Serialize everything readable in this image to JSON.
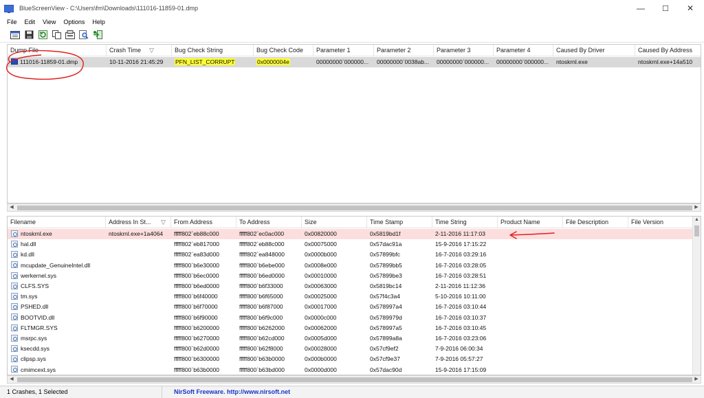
{
  "window": {
    "title": "BlueScreenView  -  C:\\Users\\fm\\Downloads\\111016-11859-01.dmp",
    "minimize": "—",
    "maximize": "☐",
    "close": "✕"
  },
  "menu": [
    "File",
    "Edit",
    "View",
    "Options",
    "Help"
  ],
  "toolbar": {
    "icons": [
      "properties-icon",
      "save-icon",
      "refresh-icon",
      "copy-icon",
      "options-icon",
      "find-icon",
      "exit-icon"
    ]
  },
  "crashes": {
    "columns": [
      "Dump File",
      "Crash Time",
      "Bug Check String",
      "Bug Check Code",
      "Parameter 1",
      "Parameter 2",
      "Parameter 3",
      "Parameter 4",
      "Caused By Driver",
      "Caused By Address"
    ],
    "sort_indicator": "▽",
    "rows": [
      {
        "dump_file": "111016-11859-01.dmp",
        "crash_time": "10-11-2016 21:45:29",
        "bug_check_string": "PFN_LIST_CORRUPT",
        "bug_check_code": "0x0000004e",
        "param1": "00000000`000000...",
        "param2": "00000000`0038ab...",
        "param3": "00000000`000000...",
        "param4": "00000000`000000...",
        "caused_by_driver": "ntoskrnl.exe",
        "caused_by_address": "ntoskrnl.exe+14a510"
      }
    ]
  },
  "drivers": {
    "columns": [
      "Filename",
      "Address In St...",
      "From Address",
      "To Address",
      "Size",
      "Time Stamp",
      "Time String",
      "Product Name",
      "File Description",
      "File Version"
    ],
    "sort_indicator": "▽",
    "rows": [
      {
        "filename": "ntoskrnl.exe",
        "addr_in_stack": "ntoskrnl.exe+1a4064",
        "from": "fffff802`eb88c000",
        "to": "fffff802`ec0ac000",
        "size": "0x00820000",
        "timestamp": "0x5819bd1f",
        "timestring": "2-11-2016 11:17:03"
      },
      {
        "filename": "hal.dll",
        "addr_in_stack": "",
        "from": "fffff802`eb817000",
        "to": "fffff802`eb88c000",
        "size": "0x00075000",
        "timestamp": "0x57dac91a",
        "timestring": "15-9-2016 17:15:22"
      },
      {
        "filename": "kd.dll",
        "addr_in_stack": "",
        "from": "fffff802`ea83d000",
        "to": "fffff802`ea848000",
        "size": "0x0000b000",
        "timestamp": "0x57899bfc",
        "timestring": "16-7-2016 03:29:16"
      },
      {
        "filename": "mcupdate_GenuineIntel.dll",
        "addr_in_stack": "",
        "from": "fffff800`b6e30000",
        "to": "fffff800`b6ebe000",
        "size": "0x0008e000",
        "timestamp": "0x57899bb5",
        "timestring": "16-7-2016 03:28:05"
      },
      {
        "filename": "werkernel.sys",
        "addr_in_stack": "",
        "from": "fffff800`b6ec0000",
        "to": "fffff800`b6ed0000",
        "size": "0x00010000",
        "timestamp": "0x57899be3",
        "timestring": "16-7-2016 03:28:51"
      },
      {
        "filename": "CLFS.SYS",
        "addr_in_stack": "",
        "from": "fffff800`b6ed0000",
        "to": "fffff800`b6f33000",
        "size": "0x00063000",
        "timestamp": "0x5819bc14",
        "timestring": "2-11-2016 11:12:36"
      },
      {
        "filename": "tm.sys",
        "addr_in_stack": "",
        "from": "fffff800`b6f40000",
        "to": "fffff800`b6f65000",
        "size": "0x00025000",
        "timestamp": "0x57f4c3a4",
        "timestring": "5-10-2016 10:11:00"
      },
      {
        "filename": "PSHED.dll",
        "addr_in_stack": "",
        "from": "fffff800`b6f70000",
        "to": "fffff800`b6f87000",
        "size": "0x00017000",
        "timestamp": "0x578997a4",
        "timestring": "16-7-2016 03:10:44"
      },
      {
        "filename": "BOOTVID.dll",
        "addr_in_stack": "",
        "from": "fffff800`b6f90000",
        "to": "fffff800`b6f9c000",
        "size": "0x0000c000",
        "timestamp": "0x5789979d",
        "timestring": "16-7-2016 03:10:37"
      },
      {
        "filename": "FLTMGR.SYS",
        "addr_in_stack": "",
        "from": "fffff800`b6200000",
        "to": "fffff800`b6262000",
        "size": "0x00062000",
        "timestamp": "0x578997a5",
        "timestring": "16-7-2016 03:10:45"
      },
      {
        "filename": "msrpc.sys",
        "addr_in_stack": "",
        "from": "fffff800`b6270000",
        "to": "fffff800`b62cd000",
        "size": "0x0005d000",
        "timestamp": "0x57899a8a",
        "timestring": "16-7-2016 03:23:06"
      },
      {
        "filename": "ksecdd.sys",
        "addr_in_stack": "",
        "from": "fffff800`b62d0000",
        "to": "fffff800`b62f8000",
        "size": "0x00028000",
        "timestamp": "0x57cf9ef2",
        "timestring": "7-9-2016 06:00:34"
      },
      {
        "filename": "clipsp.sys",
        "addr_in_stack": "",
        "from": "fffff800`b6300000",
        "to": "fffff800`b63b0000",
        "size": "0x000b0000",
        "timestamp": "0x57cf9e37",
        "timestring": "7-9-2016 05:57:27"
      },
      {
        "filename": "cmimcext.sys",
        "addr_in_stack": "",
        "from": "fffff800`b63b0000",
        "to": "fffff800`b63bd000",
        "size": "0x0000d000",
        "timestamp": "0x57dac90d",
        "timestring": "15-9-2016 17:15:09"
      }
    ]
  },
  "status": {
    "count": "1 Crashes, 1 Selected",
    "link": "NirSoft Freeware.  http://www.nirsoft.net"
  },
  "colors": {
    "highlight": "#ffff2e",
    "selected_row": "#d9d9d9",
    "pink_row": "#fcdede",
    "annotation": "#e02020",
    "link": "#1a34c8"
  }
}
